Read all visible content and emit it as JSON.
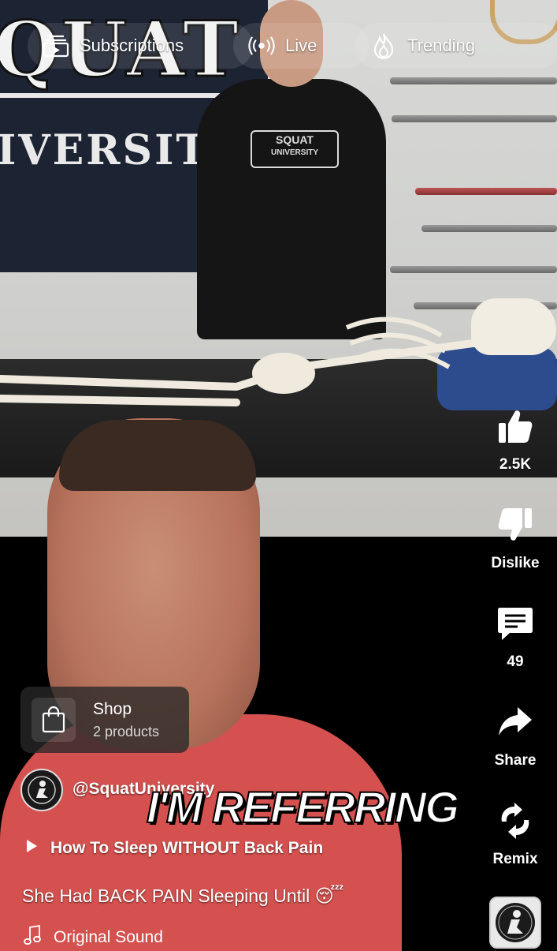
{
  "nav": {
    "subscriptions": {
      "label": "Subscriptions",
      "icon": "subscriptions-icon"
    },
    "live": {
      "label": "Live",
      "icon": "live-broadcast-icon"
    },
    "trending": {
      "label": "Trending",
      "icon": "flame-icon"
    }
  },
  "actions": {
    "like": {
      "label": "2.5K",
      "icon": "thumbs-up-icon"
    },
    "dislike": {
      "label": "Dislike",
      "icon": "thumbs-down-icon"
    },
    "comments": {
      "label": "49",
      "icon": "comment-icon"
    },
    "share": {
      "label": "Share",
      "icon": "share-arrow-icon"
    },
    "remix": {
      "label": "Remix",
      "icon": "remix-icon"
    }
  },
  "shop": {
    "title": "Shop",
    "subtitle": "2 products",
    "icon": "shopping-bag-icon"
  },
  "channel": {
    "handle": "@SquatUniversity"
  },
  "video": {
    "caption_overlay": "I'M REFERRING",
    "playlist_title": "How To Sleep WITHOUT Back Pain",
    "title": "She Had BACK PAIN Sleeping Until 😴",
    "sound": "Original Sound"
  },
  "scene": {
    "banner_line1": "QUAT",
    "banner_line2": "IVERSIT",
    "shirt_line1": "SQUAT",
    "shirt_line2": "UNIVERSITY"
  },
  "colors": {
    "accent_white": "#ffffff",
    "shirt_red": "#d4514f",
    "banner_navy": "#1c2333"
  }
}
